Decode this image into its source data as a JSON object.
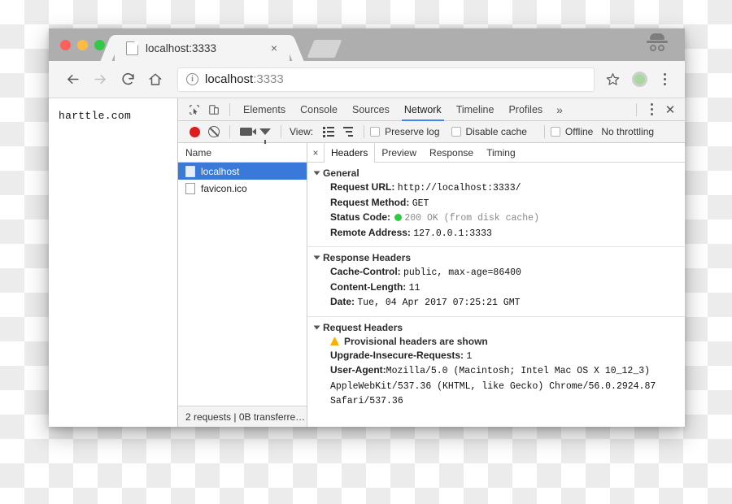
{
  "browser": {
    "tab": {
      "title": "localhost:3333",
      "favicon": "page-icon",
      "close": "×"
    },
    "new_tab_label": "+",
    "incognito": "incognito-icon",
    "nav": {
      "back": "←",
      "forward": "→",
      "reload": "↻",
      "home": "⌂"
    },
    "omnibox": {
      "info": "i",
      "host": "localhost",
      "port": ":3333"
    },
    "star": "☆",
    "menu": "kebab-menu"
  },
  "page": {
    "text": "harttle.com"
  },
  "devtools": {
    "inspect_icon": "cursor-select-icon",
    "device_icon": "device-toggle-icon",
    "tabs": [
      {
        "label": "Elements",
        "active": false
      },
      {
        "label": "Console",
        "active": false
      },
      {
        "label": "Sources",
        "active": false
      },
      {
        "label": "Network",
        "active": true
      },
      {
        "label": "Timeline",
        "active": false
      },
      {
        "label": "Profiles",
        "active": false
      }
    ],
    "more_tabs": "»",
    "menu": "kebab-menu",
    "close": "✕",
    "network_bar": {
      "record": "record-button",
      "clear": "clear-button",
      "camera": "capture-screenshots-button",
      "filter": "filter-button",
      "view_label": "View:",
      "view_list": "list-view-icon",
      "view_waterfall": "waterfall-view-icon",
      "preserve_log": "Preserve log",
      "disable_cache": "Disable cache",
      "offline": "Offline",
      "throttling": "No throttling"
    },
    "request_list": {
      "column": "Name",
      "rows": [
        {
          "name": "localhost",
          "selected": true
        },
        {
          "name": "favicon.ico",
          "selected": false
        }
      ],
      "status": "2 requests | 0B transferre…"
    },
    "detail": {
      "close": "×",
      "tabs": [
        {
          "label": "Headers",
          "active": true
        },
        {
          "label": "Preview",
          "active": false
        },
        {
          "label": "Response",
          "active": false
        },
        {
          "label": "Timing",
          "active": false
        }
      ],
      "sections": [
        {
          "title": "General",
          "rows": [
            {
              "key": "Request URL:",
              "value": "http://localhost:3333/"
            },
            {
              "key": "Request Method:",
              "value": "GET"
            },
            {
              "key": "Status Code:",
              "value": "200 OK (from disk cache)",
              "dot": true,
              "muted": true
            },
            {
              "key": "Remote Address:",
              "value": "127.0.0.1:3333"
            }
          ]
        },
        {
          "title": "Response Headers",
          "rows": [
            {
              "key": "Cache-Control:",
              "value": "public, max-age=86400"
            },
            {
              "key": "Content-Length:",
              "value": "11"
            },
            {
              "key": "Date:",
              "value": "Tue, 04 Apr 2017 07:25:21 GMT"
            }
          ]
        },
        {
          "title": "Request Headers",
          "warning": "Provisional headers are shown",
          "rows": [
            {
              "key": "Upgrade-Insecure-Requests:",
              "value": "1"
            }
          ],
          "user_agent_key": "User-Agent:",
          "user_agent_value": "Mozilla/5.0 (Macintosh; Intel Mac OS X 10_12_3) AppleWebKit/537.36 (KHTML, like Gecko) Chrome/56.0.2924.87 Safari/537.36"
        }
      ]
    }
  },
  "colors": {
    "accent_blue": "#4285f4",
    "selection_blue": "#3879d9",
    "record_red": "#e01b1b",
    "status_green": "#2ecc40",
    "warning_yellow": "#f5b301"
  }
}
